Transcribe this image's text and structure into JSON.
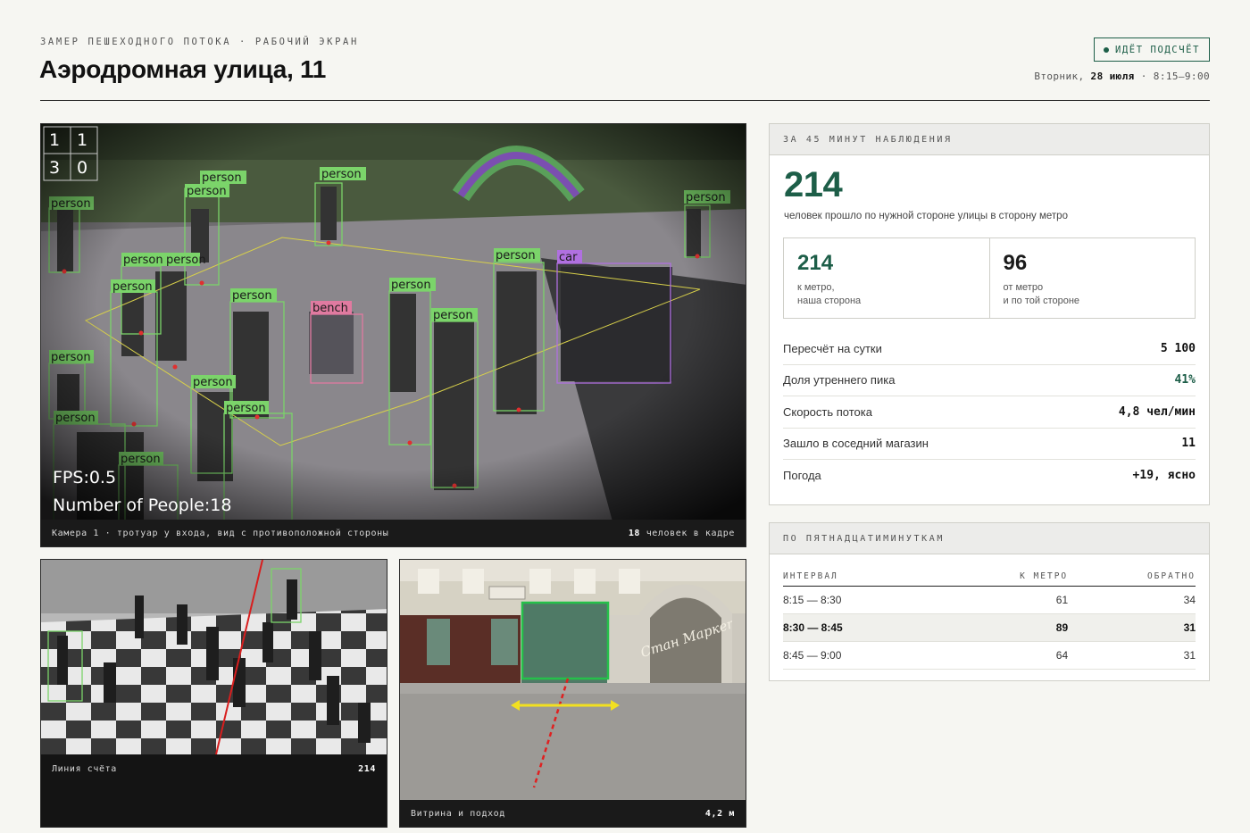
{
  "header": {
    "kicker": "ЗАМЕР ПЕШЕХОДНОГО ПОТОКА · РАБОЧИЙ ЭКРАН",
    "title": "Аэродромная улица, 11",
    "badge": "ИДЁТ ПОДСЧЁТ",
    "day": "Вторник,",
    "date": "28 июля",
    "time": "· 8:15–9:00"
  },
  "cameras": {
    "main": {
      "caption": "Камера 1 · тротуар у входа, вид с противоположной стороны",
      "count": "18",
      "count_suffix": "человек в кадре",
      "overlay_grid": [
        "1",
        "1",
        "3",
        "0"
      ],
      "fps": "FPS:0.5",
      "people": "Number of People:18",
      "labels": {
        "person": "person",
        "bench": "bench",
        "car": "car"
      }
    },
    "line": {
      "caption": "Линия счёта",
      "value": "214"
    },
    "storefront": {
      "caption": "Витрина и подход",
      "value": "4,2 м",
      "sign": "Стан Маркет"
    }
  },
  "summary": {
    "head": "ЗА 45 МИНУТ НАБЛЮДЕНИЯ",
    "total": "214",
    "total_desc": "человек прошло по нужной стороне улицы в сторону метро",
    "to_metro": {
      "value": "214",
      "desc": "к метро,\nнаша сторона"
    },
    "from_metro": {
      "value": "96",
      "desc": "от метро\nи по той стороне"
    },
    "stats": [
      {
        "label": "Пересчёт на сутки",
        "value": "5 100"
      },
      {
        "label": "Доля утреннего пика",
        "value": "41%"
      },
      {
        "label": "Скорость потока",
        "value": "4,8 чел/мин"
      },
      {
        "label": "Зашло в соседний магазин",
        "value": "11"
      },
      {
        "label": "Погода",
        "value": "+19, ясно"
      }
    ]
  },
  "intervals": {
    "head": "ПО ПЯТНАДЦАТИМИНУТКАМ",
    "columns": [
      "ИНТЕРВАЛ",
      "К МЕТРО",
      "ОБРАТНО"
    ],
    "rows": [
      {
        "interval": "8:15 — 8:30",
        "to": "61",
        "back": "34"
      },
      {
        "interval": "8:30 — 8:45",
        "to": "89",
        "back": "31"
      },
      {
        "interval": "8:45 — 9:00",
        "to": "64",
        "back": "31"
      }
    ]
  },
  "colors": {
    "accent": "#1d5e48",
    "detect_person": "#7bd46a",
    "detect_bench": "#e07aa0",
    "detect_car": "#b070e0"
  }
}
